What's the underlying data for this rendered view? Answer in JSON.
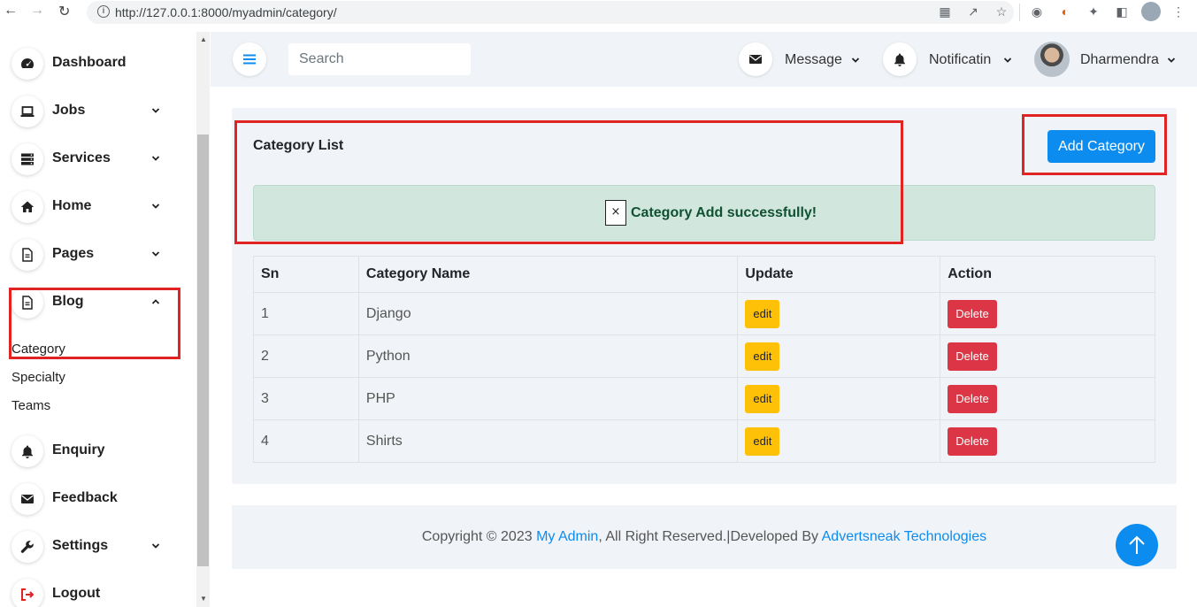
{
  "browser": {
    "url": "http://127.0.0.1:8000/myadmin/category/"
  },
  "sidebar": {
    "items": [
      {
        "label": "Dashboard",
        "icon": "dashboard-icon"
      },
      {
        "label": "Jobs",
        "icon": "laptop-icon"
      },
      {
        "label": "Services",
        "icon": "server-icon"
      },
      {
        "label": "Home",
        "icon": "home-icon"
      },
      {
        "label": "Pages",
        "icon": "file-icon"
      },
      {
        "label": "Blog",
        "icon": "file-icon"
      },
      {
        "label": "Enquiry",
        "icon": "bell-icon"
      },
      {
        "label": "Feedback",
        "icon": "envelope-icon"
      },
      {
        "label": "Settings",
        "icon": "wrench-icon"
      },
      {
        "label": "Logout",
        "icon": "logout-icon"
      }
    ],
    "blog_sub": [
      "Category",
      "Specialty",
      "Teams"
    ]
  },
  "header": {
    "search_placeholder": "Search",
    "message_label": "Message",
    "notification_label": "Notificatin",
    "user_name": "Dharmendra"
  },
  "content": {
    "title": "Category List",
    "add_button": "Add Category",
    "alert_close": "×",
    "alert_text": "Category Add successfully!",
    "table": {
      "headers": [
        "Sn",
        "Category Name",
        "Update",
        "Action"
      ],
      "rows": [
        {
          "sn": "1",
          "name": "Django",
          "edit": "edit",
          "delete": "Delete"
        },
        {
          "sn": "2",
          "name": "Python",
          "edit": "edit",
          "delete": "Delete"
        },
        {
          "sn": "3",
          "name": "PHP",
          "edit": "edit",
          "delete": "Delete"
        },
        {
          "sn": "4",
          "name": "Shirts",
          "edit": "edit",
          "delete": "Delete"
        }
      ]
    }
  },
  "footer": {
    "prefix": "Copyright © 2023 ",
    "brand": "My Admin",
    "middle": ", All Right Reserved.|Developed By ",
    "developer": "Advertsneak Technologies"
  },
  "colors": {
    "accent": "#0d8cf0",
    "edit": "#ffc107",
    "delete": "#dc3545",
    "alert_bg": "#d1e7dd",
    "highlight": "#e02424"
  }
}
